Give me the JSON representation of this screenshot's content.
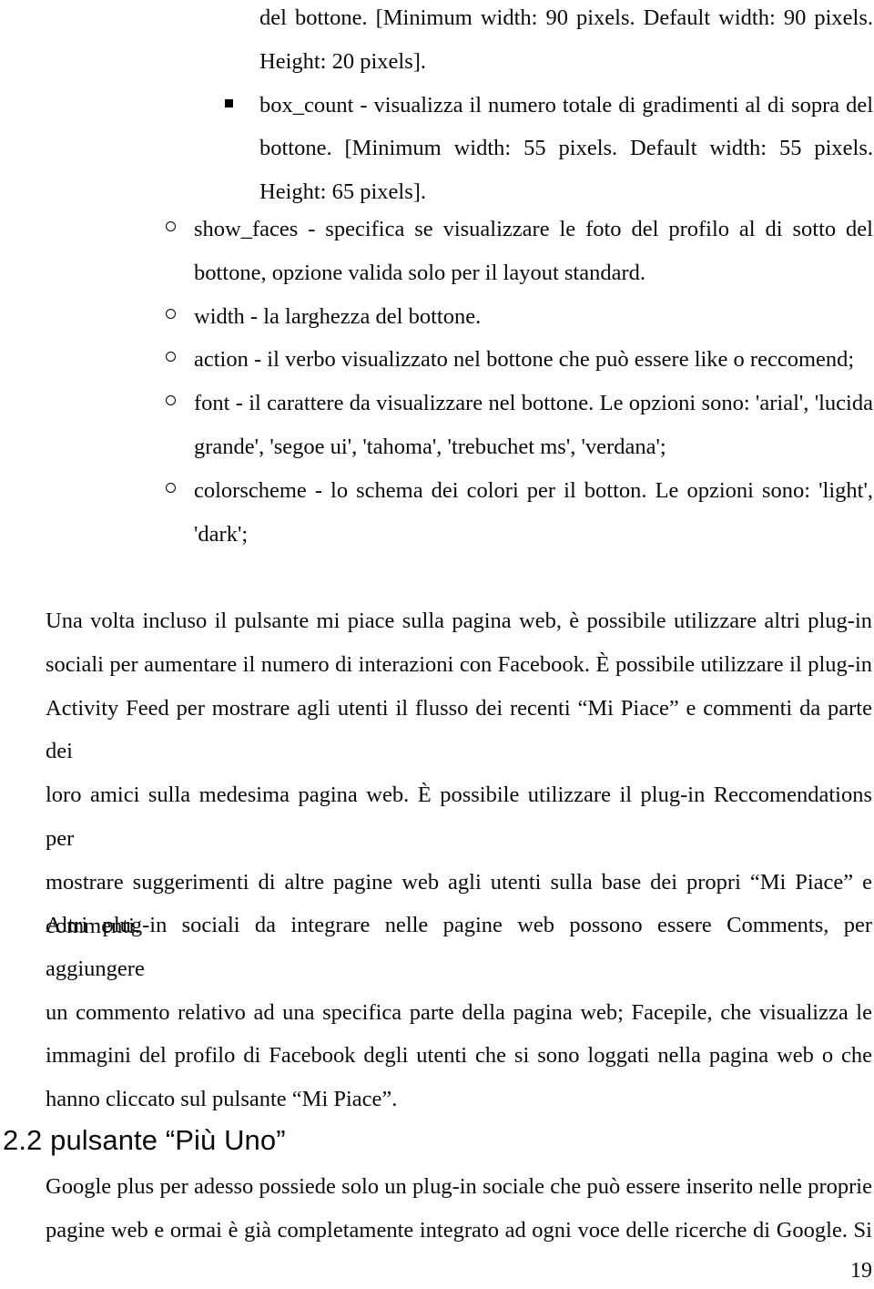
{
  "document": {
    "language": "it",
    "page_number": "19",
    "background_color": "#ffffff",
    "text_color": "#0b0b0b"
  },
  "square_bullet_list": {
    "marker": "square-bullet",
    "continuation_of_previous_item": {
      "line1": "del bottone. [Minimum width: 90 pixels. Default width: 90 pixels.",
      "line2": "Height: 20 pixels]."
    },
    "items": [
      {
        "marker": "square-bullet",
        "line1": "box_count - visualizza il numero totale di gradimenti al di sopra del",
        "line2": "bottone. [Minimum width: 55 pixels. Default width: 55 pixels.",
        "line3": "Height: 65 pixels]."
      }
    ]
  },
  "circle_bullet_list": {
    "marker": "circle-bullet",
    "items": [
      {
        "line1": "show_faces - specifica se visualizzare le foto del profilo al di sotto del",
        "line2": "bottone, opzione valida solo per il layout standard."
      },
      {
        "line1": "width - la larghezza del bottone."
      },
      {
        "line1": "action - il verbo visualizzato nel bottone che può essere like o reccomend;"
      },
      {
        "line1": "font - il carattere da visualizzare nel bottone. Le opzioni sono: 'arial', 'lucida",
        "line2": "grande', 'segoe ui', 'tahoma', 'trebuchet ms', 'verdana';"
      },
      {
        "line1": "colorscheme - lo schema dei colori per il botton. Le opzioni sono: 'light',",
        "line2": "'dark';"
      }
    ]
  },
  "paragraphs": [
    {
      "id": "paragraph-plugin-sociali",
      "line1": "Una volta incluso il pulsante mi piace sulla pagina web, è possibile utilizzare altri plug-in",
      "line2": "sociali per aumentare il numero di interazioni con Facebook. È possibile utilizzare il plug-in",
      "line3": "Activity Feed per mostrare agli utenti il flusso dei recenti “Mi Piace” e commenti da parte dei",
      "line4": "loro amici sulla medesima pagina web. È possibile utilizzare il plug-in Reccomendations per",
      "line5": "mostrare suggerimenti di altre pagine web agli utenti sulla base dei propri “Mi Piace” e",
      "line6": "commenti."
    },
    {
      "id": "paragraph-altri-plugin",
      "line1": "Altri plug-in sociali da integrare nelle pagine web possono essere Comments, per aggiungere",
      "line2": "un commento relativo ad una specifica parte della pagina web; Facepile, che visualizza le",
      "line3": "immagini del profilo di Facebook degli utenti che si sono loggati nella pagina web o che",
      "line4": "hanno cliccato sul pulsante “Mi Piace”."
    }
  ],
  "section": {
    "heading": "2.2 pulsante “Più Uno”",
    "paragraph": {
      "id": "paragraph-google-plus",
      "line1": "Google plus per adesso possiede solo un plug-in sociale che può essere inserito nelle proprie",
      "line2": "pagine web e ormai è già completamente integrato ad ogni voce delle ricerche di Google. Si"
    }
  }
}
